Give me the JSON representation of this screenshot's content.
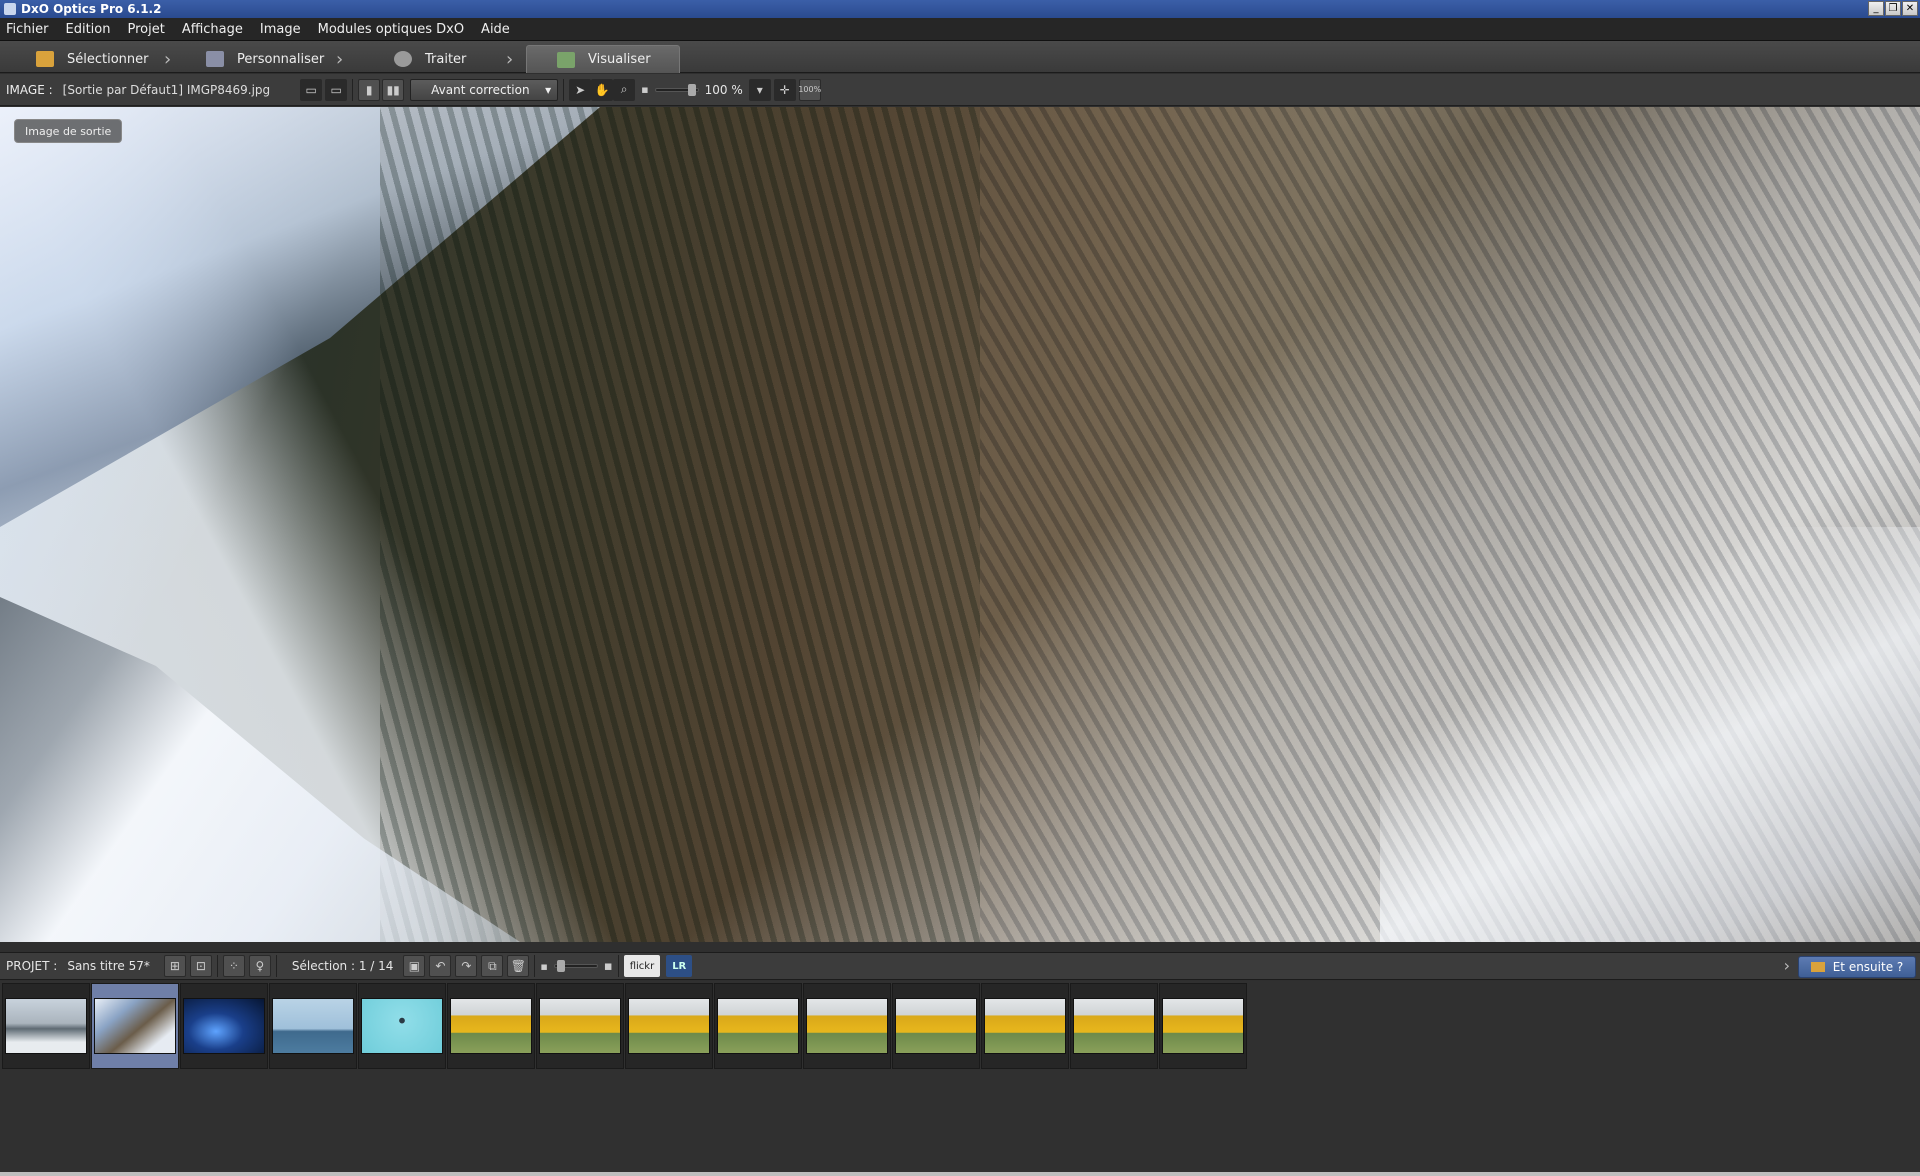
{
  "window": {
    "title": "DxO Optics Pro 6.1.2"
  },
  "menu": [
    "Fichier",
    "Edition",
    "Projet",
    "Affichage",
    "Image",
    "Modules optiques DxO",
    "Aide"
  ],
  "tabs": [
    {
      "label": "Sélectionner",
      "icon": "folder-icon",
      "active": false
    },
    {
      "label": "Personnaliser",
      "icon": "customize-icon",
      "active": false
    },
    {
      "label": "Traiter",
      "icon": "process-icon",
      "active": false
    },
    {
      "label": "Visualiser",
      "icon": "view-icon",
      "active": true
    }
  ],
  "image_toolbar": {
    "label": "IMAGE :",
    "value": "[Sortie par Défaut1] IMGP8469.jpg",
    "view_mode": "Avant correction",
    "zoom": "100 %",
    "zoom_fit_label": "100%"
  },
  "viewer": {
    "badge": "Image de sortie"
  },
  "project_bar": {
    "label": "PROJET :",
    "value": "Sans titre 57*",
    "selection": "Sélection : 1 / 14",
    "flickr_label": "flickr",
    "lr_label": "LR",
    "next_button": "Et ensuite ?"
  },
  "filmstrip": {
    "thumbs": [
      {
        "kind": "t-city"
      },
      {
        "kind": "t-mount",
        "selected": true
      },
      {
        "kind": "t-blue"
      },
      {
        "kind": "t-sea"
      },
      {
        "kind": "t-balloon"
      },
      {
        "kind": "t-yellow"
      },
      {
        "kind": "t-yellow"
      },
      {
        "kind": "t-yellow"
      },
      {
        "kind": "t-yellow"
      },
      {
        "kind": "t-yellow"
      },
      {
        "kind": "t-yellow"
      },
      {
        "kind": "t-yellow"
      },
      {
        "kind": "t-yellow"
      },
      {
        "kind": "t-yellow"
      }
    ]
  },
  "colors": {
    "accent": "#4f6ea6",
    "selected_thumb": "#6f7fa8"
  }
}
